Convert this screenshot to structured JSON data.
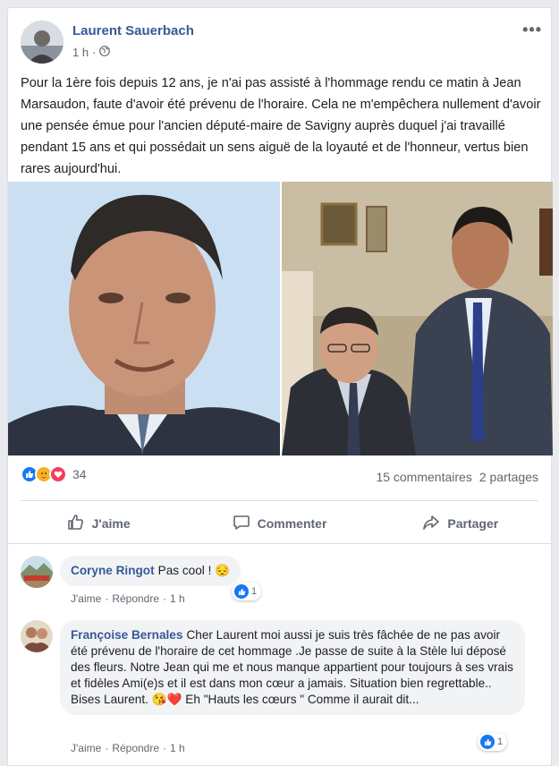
{
  "post": {
    "author": "Laurent Sauerbach",
    "time": "1 h",
    "privacy_dot": "·",
    "text": "Pour la 1ère fois depuis 12 ans, je n'ai pas assisté à l'hommage rendu ce matin à Jean Marsaudon, faute d'avoir été prévenu de l'horaire. Cela ne m'empêchera nullement d'avoir une pensée émue pour l'ancien député-maire de Savigny auprès duquel j'ai travaillé pendant 15 ans et qui possédait un sens aiguë de la loyauté et de l'honneur, vertus bien rares aujourd'hui.",
    "more_icon": "•••"
  },
  "reactions": {
    "count": "34",
    "icons": [
      "like-icon",
      "care-icon",
      "love-icon"
    ],
    "comments": "15 commentaires",
    "shares": "2 partages"
  },
  "actions": {
    "like": "J'aime",
    "comment": "Commenter",
    "share": "Partager"
  },
  "comments": [
    {
      "name": "Coryne Ringot",
      "text": "Pas cool ! 😔",
      "like_label": "J'aime",
      "reply_label": "Répondre",
      "time": "1 h",
      "likes": "1"
    },
    {
      "name": "Françoise Bernales",
      "text": "Cher Laurent moi aussi je suis très fâchée de ne pas avoir été prévenu de l'horaire de cet hommage .Je passe de suite à la Stèle lui déposé des fleurs. Notre Jean qui me et nous manque appartient pour toujours à ses vrais et fidèles Ami(e)s et il est dans mon cœur a jamais. Situation bien regrettable.. Bises Laurent. 😘❤️ Eh \"Hauts les cœurs \" Comme il aurait dit...",
      "like_label": "J'aime",
      "reply_label": "Répondre",
      "time": "1 h",
      "likes": "1"
    }
  ],
  "colors": {
    "link_blue": "#385898",
    "fb_blue": "#1877f2",
    "love_red": "#f33e58",
    "care_yellow": "#f7b125"
  }
}
